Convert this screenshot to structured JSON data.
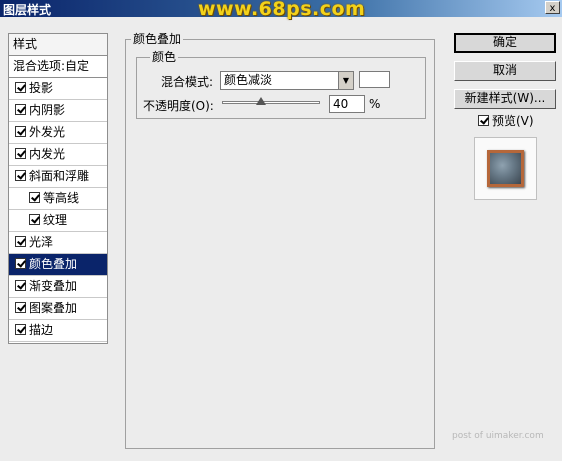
{
  "window": {
    "title": "图层样式",
    "watermark": "www.68ps.com",
    "close_glyph": "x"
  },
  "style_list": {
    "header": "样式",
    "blend_options": "混合选项:自定",
    "items": [
      {
        "label": "投影",
        "checked": true
      },
      {
        "label": "内阴影",
        "checked": true
      },
      {
        "label": "外发光",
        "checked": true
      },
      {
        "label": "内发光",
        "checked": true
      },
      {
        "label": "斜面和浮雕",
        "checked": true
      },
      {
        "label": "等高线",
        "checked": true
      },
      {
        "label": "纹理",
        "checked": true
      },
      {
        "label": "光泽",
        "checked": true
      },
      {
        "label": "颜色叠加",
        "checked": true,
        "selected": true
      },
      {
        "label": "渐变叠加",
        "checked": true
      },
      {
        "label": "图案叠加",
        "checked": true
      },
      {
        "label": "描边",
        "checked": true
      }
    ]
  },
  "panel": {
    "group_title": "颜色叠加",
    "inner_title": "颜色",
    "blend_mode_label": "混合模式:",
    "blend_mode_value": "颜色减淡",
    "color_swatch": "#ffffff",
    "opacity_label": "不透明度(O):",
    "opacity_value": "40",
    "opacity_fraction": 0.4,
    "percent_sign": "%"
  },
  "buttons": {
    "ok": "确定",
    "cancel": "取消",
    "new_style": "新建样式(W)...",
    "preview_label": "预览(V)",
    "preview_checked": true
  },
  "footer": "post of uimaker.com"
}
